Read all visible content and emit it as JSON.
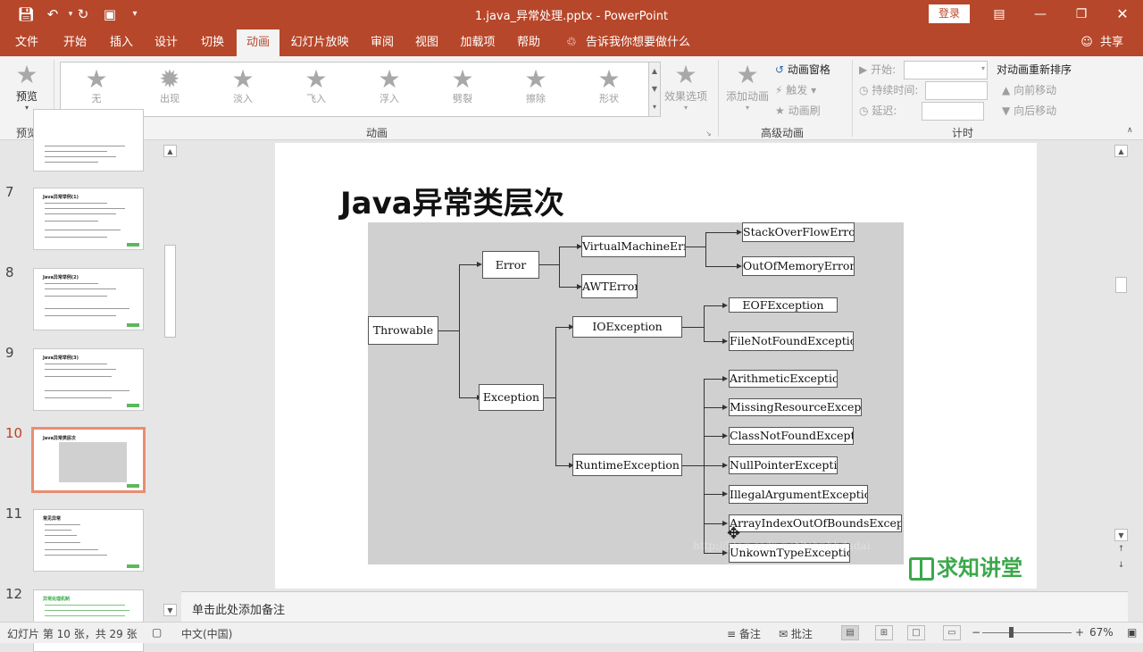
{
  "app": {
    "doc_title": "1.java_异常处理.pptx  -  PowerPoint",
    "login_label": "登录",
    "icons": {
      "save": "save-icon",
      "undo": "undo-icon",
      "redo": "redo-icon",
      "present": "slideshow-icon",
      "customize": "customize-qat-icon"
    }
  },
  "tabs": [
    {
      "label": "文件"
    },
    {
      "label": "开始"
    },
    {
      "label": "插入"
    },
    {
      "label": "设计"
    },
    {
      "label": "切换"
    },
    {
      "label": "动画"
    },
    {
      "label": "幻灯片放映"
    },
    {
      "label": "审阅"
    },
    {
      "label": "视图"
    },
    {
      "label": "加载项"
    },
    {
      "label": "帮助"
    }
  ],
  "tell_me": "告诉我你想要做什么",
  "share": "共享",
  "ribbon": {
    "preview_label": "预览",
    "preview_group": "预览",
    "gallery": [
      "无",
      "出现",
      "淡入",
      "飞入",
      "浮入",
      "劈裂",
      "擦除",
      "形状"
    ],
    "effect_options": "效果选项",
    "animation_group": "动画",
    "add_animation": "添加动画",
    "animation_pane": "动画窗格",
    "trigger": "触发",
    "painter": "动画刷",
    "advanced_group": "高级动画",
    "start_label": "开始:",
    "duration_label": "持续时间:",
    "delay_label": "延迟:",
    "reorder_label": "对动画重新排序",
    "move_earlier": "向前移动",
    "move_later": "向后移动",
    "timing_group": "计时"
  },
  "slides": [
    {
      "num": "7",
      "title": "Java异常举例(1)"
    },
    {
      "num": "8",
      "title": "Java异常举例(2)"
    },
    {
      "num": "9",
      "title": "Java异常举例(3)"
    },
    {
      "num": "10",
      "title": "Java异常类层次"
    },
    {
      "num": "11",
      "title": "常见异常"
    },
    {
      "num": "12",
      "title": "异常处理机制"
    }
  ],
  "slide": {
    "title": "Java异常类层次",
    "nodes": {
      "throwable": "Throwable",
      "error": "Error",
      "exception": "Exception",
      "vme": "VirtualMachineError",
      "awt": "AWTError",
      "soe": "StackOverFlowError",
      "oome": "OutOfMemoryError",
      "io": "IOException",
      "eof": "EOFException",
      "fnf": "FileNotFoundException",
      "rt": "RuntimeException",
      "arith": "ArithmeticException",
      "missing": "MissingResourceException",
      "cnf": "ClassNotFoundException",
      "npe": "NullPointerException",
      "iae": "IllegalArgumentException",
      "aioobe": "ArrayIndexOutOfBoundsException",
      "unknown": "UnkownTypeException"
    },
    "watermark": "http://blog.csdn.net/tsbnhbdadai",
    "logo_text": "求知讲堂"
  },
  "notes_placeholder": "单击此处添加备注",
  "status": {
    "slide_info": "幻灯片 第 10 张，共 29 张",
    "language": "中文(中国)",
    "notes": "备注",
    "comments": "批注",
    "zoom": "67%"
  }
}
